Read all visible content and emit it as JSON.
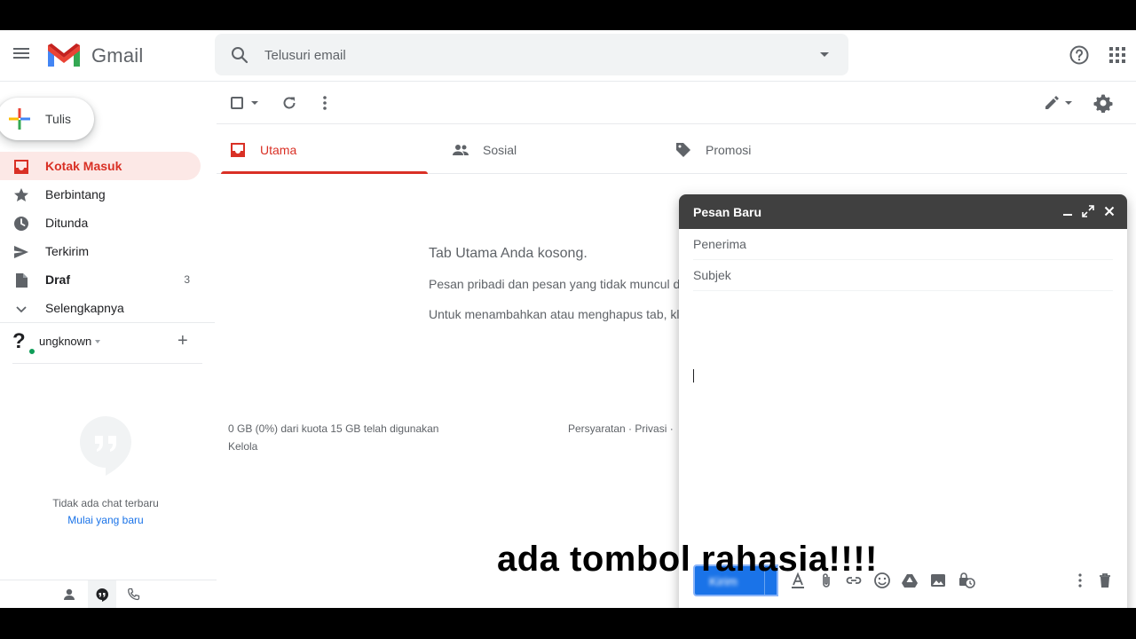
{
  "app": {
    "name": "Gmail"
  },
  "search": {
    "placeholder": "Telusuri email"
  },
  "compose_button": {
    "label": "Tulis"
  },
  "sidebar": {
    "items": [
      {
        "label": "Kotak Masuk",
        "icon": "inbox-icon",
        "active": true
      },
      {
        "label": "Berbintang",
        "icon": "star-icon"
      },
      {
        "label": "Ditunda",
        "icon": "clock-icon"
      },
      {
        "label": "Terkirim",
        "icon": "send-icon"
      },
      {
        "label": "Draf",
        "icon": "draft-icon",
        "count": "3"
      },
      {
        "label": "Selengkapnya",
        "icon": "chevron-down-icon"
      }
    ]
  },
  "hangouts": {
    "user": "ungknown",
    "avatar_glyph": "?",
    "empty_text": "Tidak ada chat terbaru",
    "start_link": "Mulai yang baru"
  },
  "tabs": [
    {
      "label": "Utama",
      "icon": "inbox-icon",
      "active": true
    },
    {
      "label": "Sosial",
      "icon": "people-icon"
    },
    {
      "label": "Promosi",
      "icon": "tag-icon"
    }
  ],
  "main": {
    "empty_title": "Tab Utama Anda kosong.",
    "empty_line1": "Pesan pribadi dan pesan yang tidak muncul di",
    "empty_line2": "Untuk menambahkan atau menghapus tab, kli"
  },
  "footer": {
    "quota": "0 GB (0%) dari kuota 15 GB telah digunakan",
    "manage": "Kelola",
    "terms": "Persyaratan",
    "privacy": "Privasi",
    "separator": "·"
  },
  "compose": {
    "title": "Pesan Baru",
    "to_placeholder": "Penerima",
    "subject_placeholder": "Subjek",
    "send_label": "Kirim"
  },
  "caption": "ada tombol rahasia!!!!",
  "colors": {
    "accent_red": "#d93025",
    "active_bg": "#fce8e6",
    "send_blue": "#1a73e8",
    "compose_header": "#404040"
  }
}
